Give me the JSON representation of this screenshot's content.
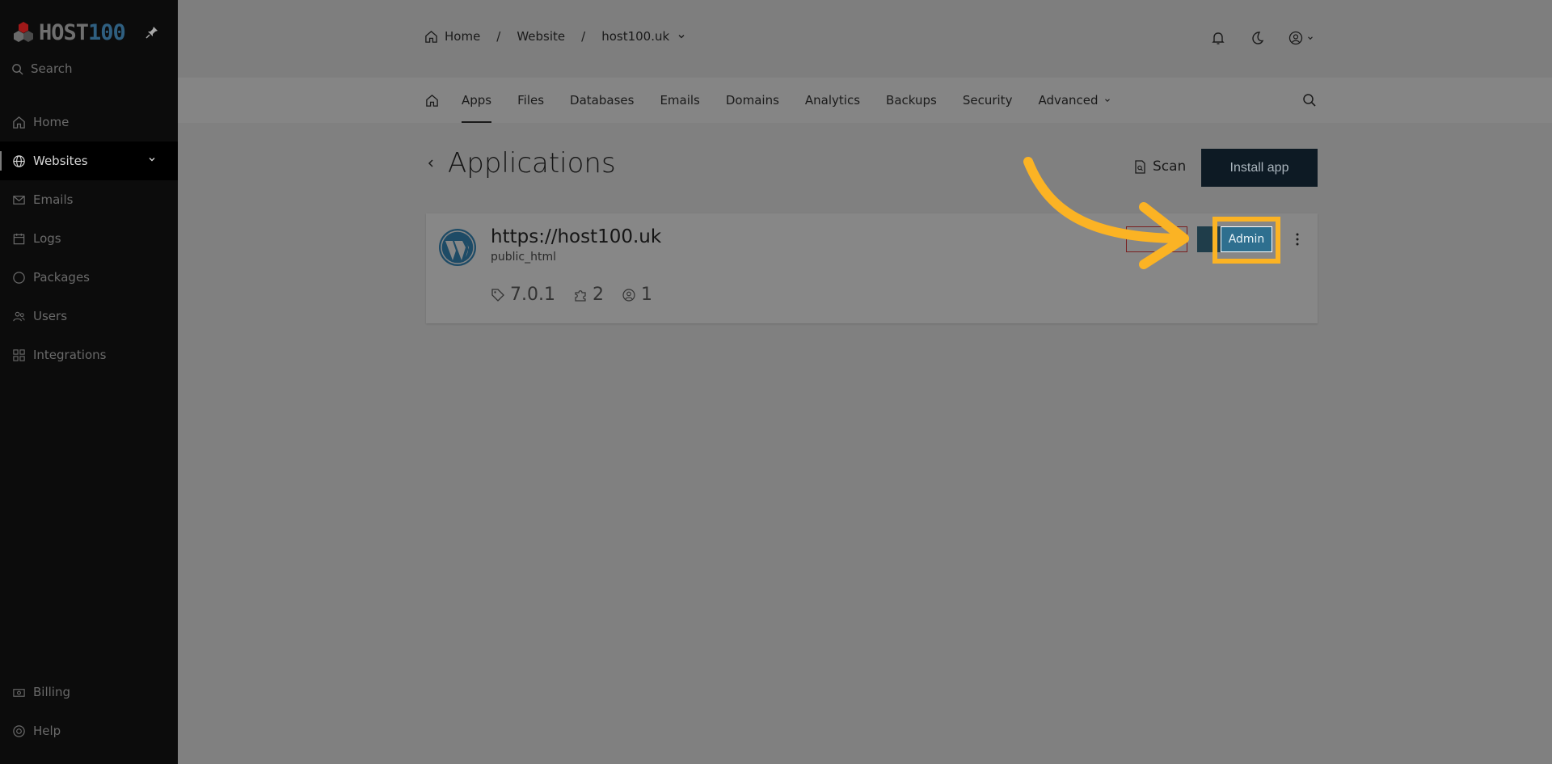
{
  "brand": {
    "logo_word": "HOST",
    "logo_num": "100"
  },
  "sidebar": {
    "search_placeholder": "Search",
    "items": [
      {
        "label": "Home",
        "icon": "home-icon"
      },
      {
        "label": "Websites",
        "icon": "globe-icon",
        "active": true
      },
      {
        "label": "Emails",
        "icon": "mail-icon"
      },
      {
        "label": "Logs",
        "icon": "calendar-icon"
      },
      {
        "label": "Packages",
        "icon": "circle-icon"
      },
      {
        "label": "Users",
        "icon": "users-icon"
      },
      {
        "label": "Integrations",
        "icon": "grid-icon"
      }
    ],
    "bottom_items": [
      {
        "label": "Billing",
        "icon": "money-icon"
      },
      {
        "label": "Help",
        "icon": "help-icon"
      }
    ]
  },
  "breadcrumb": {
    "home": "Home",
    "sep1": "/",
    "website": "Website",
    "sep2": "/",
    "domain": "host100.uk"
  },
  "tabs": [
    "Apps",
    "Files",
    "Databases",
    "Emails",
    "Domains",
    "Analytics",
    "Backups",
    "Security",
    "Advanced"
  ],
  "page": {
    "title": "Applications",
    "scan_label": "Scan",
    "install_label": "Install app"
  },
  "app": {
    "url": "https://host100.uk",
    "path": "public_html",
    "version": "7.0.1",
    "plugins": "2",
    "users": "1",
    "admin_label": "Admin"
  },
  "colors": {
    "highlight": "#fbb324",
    "admin_button": "#2e6f8f",
    "install_button": "#0d1a24"
  }
}
